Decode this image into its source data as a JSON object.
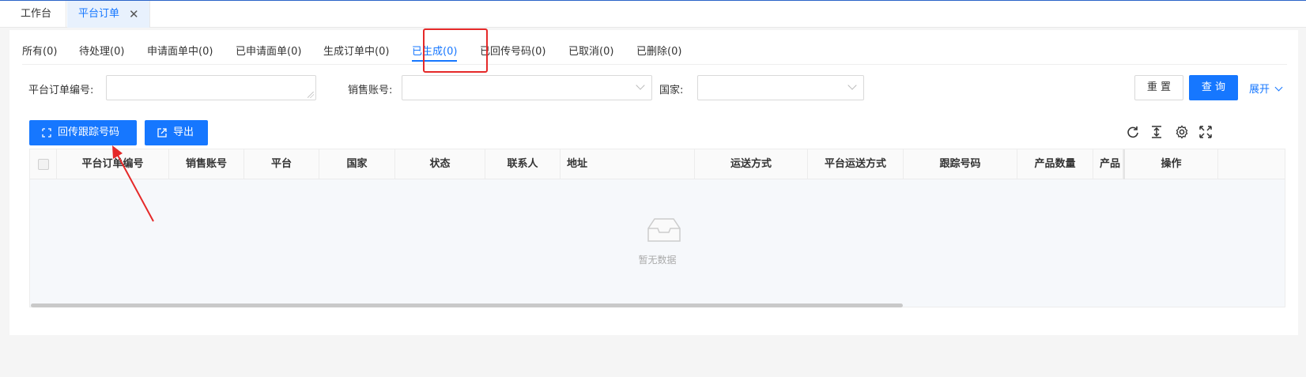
{
  "page_tabs": [
    {
      "label": "工作台"
    },
    {
      "label": "平台订单",
      "close": "✕"
    }
  ],
  "status_tabs": [
    {
      "label": "所有(0)"
    },
    {
      "label": "待处理(0)"
    },
    {
      "label": "申请面单中(0)"
    },
    {
      "label": "已申请面单(0)"
    },
    {
      "label": "生成订单中(0)"
    },
    {
      "label": "已生成(0)",
      "active": true
    },
    {
      "label": "已回传号码(0)"
    },
    {
      "label": "已取消(0)"
    },
    {
      "label": "已删除(0)"
    }
  ],
  "filters": {
    "order_no_label": "平台订单编号:",
    "order_no_value": "",
    "sales_account_label": "销售账号:",
    "sales_account_value": "",
    "country_label": "国家:",
    "country_value": ""
  },
  "actions": {
    "reset": "重 置",
    "search": "查 询",
    "expand": "展开"
  },
  "toolbar": {
    "return_tracking": "回传跟踪号码",
    "export": "导出"
  },
  "table": {
    "columns": [
      "平台订单编号",
      "销售账号",
      "平台",
      "国家",
      "状态",
      "联系人",
      "地址",
      "运送方式",
      "平台运送方式",
      "跟踪号码",
      "产品数量",
      "产品",
      "操作"
    ],
    "empty_text": "暂无数据"
  },
  "colors": {
    "primary": "#1677ff",
    "highlight": "#e52929"
  }
}
